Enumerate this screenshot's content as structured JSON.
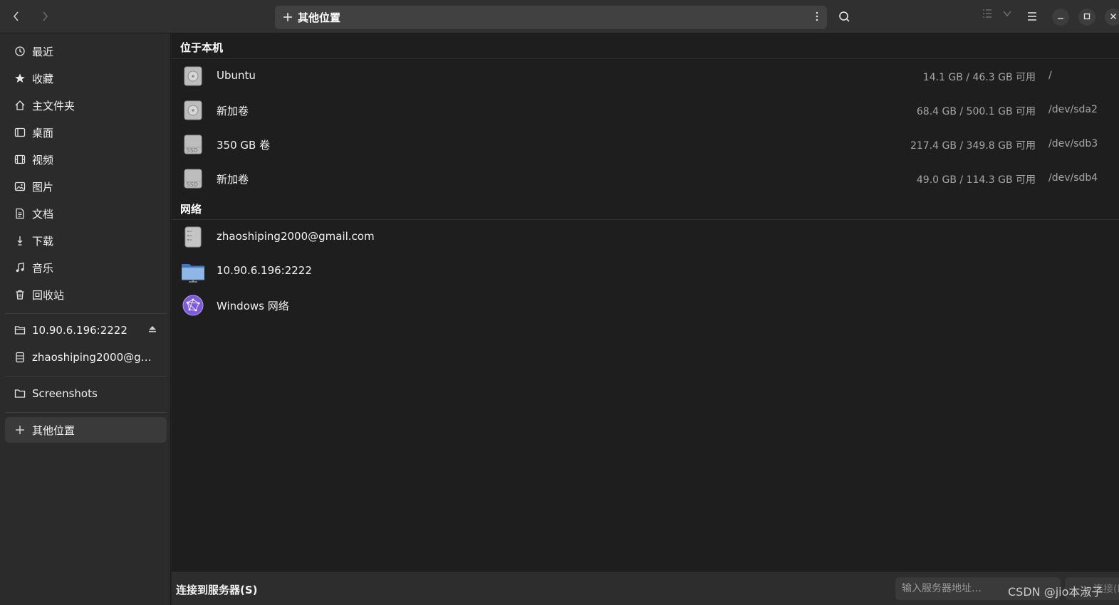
{
  "header": {
    "back_icon": "chevron-left-icon",
    "forward_icon": "chevron-right-icon",
    "path_icon": "plus-icon",
    "path_label": "其他位置",
    "path_menu_icon": "vertical-dots-icon",
    "search_icon": "search-icon",
    "view_list_icon": "list-view-icon",
    "view_dropdown_icon": "chevron-down-icon",
    "main_menu_icon": "hamburger-menu-icon",
    "minimize_icon": "minimize-icon",
    "maximize_icon": "maximize-icon",
    "close_icon": "close-icon"
  },
  "sidebar": {
    "places": [
      {
        "label": "最近",
        "icon": "clock-icon"
      },
      {
        "label": "收藏",
        "icon": "star-icon"
      },
      {
        "label": "主文件夹",
        "icon": "home-icon"
      },
      {
        "label": "桌面",
        "icon": "desktop-icon"
      },
      {
        "label": "视频",
        "icon": "video-icon"
      },
      {
        "label": "图片",
        "icon": "image-icon"
      },
      {
        "label": "文档",
        "icon": "document-icon"
      },
      {
        "label": "下载",
        "icon": "download-icon"
      },
      {
        "label": "音乐",
        "icon": "music-icon"
      },
      {
        "label": "回收站",
        "icon": "trash-icon"
      }
    ],
    "mounts": [
      {
        "label": "10.90.6.196:2222",
        "icon": "folder-network-icon",
        "eject": "eject-icon"
      },
      {
        "label": "zhaoshiping2000@gmail.com",
        "icon": "server-icon"
      }
    ],
    "bookmarks": [
      {
        "label": "Screenshots",
        "icon": "folder-icon"
      }
    ],
    "other": {
      "label": "其他位置",
      "icon": "plus-icon"
    }
  },
  "main": {
    "local_title": "位于本机",
    "local_items": [
      {
        "name": "Ubuntu",
        "size": "14.1 GB / 46.3 GB 可用",
        "path": "/",
        "icon": "hdd-icon"
      },
      {
        "name": "新加卷",
        "size": "68.4 GB / 500.1 GB 可用",
        "path": "/dev/sda2",
        "icon": "hdd-icon"
      },
      {
        "name": "350 GB 卷",
        "size": "217.4 GB / 349.8 GB 可用",
        "path": "/dev/sdb3",
        "icon": "ssd-icon"
      },
      {
        "name": "新加卷",
        "size": "49.0 GB / 114.3 GB 可用",
        "path": "/dev/sdb4",
        "icon": "ssd-icon"
      }
    ],
    "network_title": "网络",
    "network_items": [
      {
        "name": "zhaoshiping2000@gmail.com",
        "icon": "server-icon"
      },
      {
        "name": "10.90.6.196:2222",
        "icon": "network-folder-icon"
      },
      {
        "name": "Windows 网络",
        "icon": "windows-network-icon"
      }
    ]
  },
  "bottom": {
    "connect_label": "连接到服务器(S)",
    "server_placeholder": "输入服务器地址…",
    "connect_button": "连接(N)"
  },
  "watermark": "CSDN @jio本淑子"
}
